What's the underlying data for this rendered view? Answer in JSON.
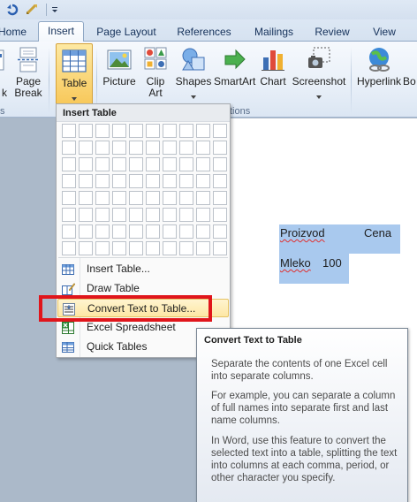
{
  "quick_access": {
    "icons": [
      "undo-icon",
      "redo-icon",
      "customize-chevron-icon"
    ]
  },
  "tabs": [
    {
      "label": "Home"
    },
    {
      "label": "Insert",
      "active": true
    },
    {
      "label": "Page Layout"
    },
    {
      "label": "References"
    },
    {
      "label": "Mailings"
    },
    {
      "label": "Review"
    },
    {
      "label": "View"
    }
  ],
  "ribbon": {
    "buttons": {
      "cover_page_fragment": "k",
      "page_break": "Page\nBreak",
      "table": "Table",
      "picture": "Picture",
      "clip_art": "Clip\nArt",
      "shapes": "Shapes",
      "smartart": "SmartArt",
      "chart": "Chart",
      "screenshot": "Screenshot",
      "hyperlink": "Hyperlink",
      "bookmark_fragment": "Bo"
    },
    "group_labels": {
      "pages_fragment": "s",
      "illustrations_fragment": "tions"
    }
  },
  "document": {
    "words": [
      "Proizvod",
      "Cena",
      "Mleko",
      "100"
    ]
  },
  "menu": {
    "header": "Insert Table",
    "grid_cols": 10,
    "grid_rows": 8,
    "items": [
      {
        "label": "Insert Table...",
        "icon": "insert-table-icon"
      },
      {
        "label": "Draw Table",
        "icon": "draw-table-icon"
      },
      {
        "label": "Convert Text to Table...",
        "icon": "convert-text-to-table-icon",
        "highlighted": true
      },
      {
        "label": "Excel Spreadsheet",
        "icon": "excel-spreadsheet-icon"
      },
      {
        "label": "Quick Tables",
        "icon": "quick-tables-icon"
      }
    ]
  },
  "tooltip": {
    "title": "Convert Text to Table",
    "paragraphs": [
      "Separate the contents of one Excel cell into separate columns.",
      "For example, you can separate a column of full names into separate first and last name columns.",
      "In Word, use this feature to convert the selected text into a table, splitting the text into columns at each comma, period, or other character you specify."
    ]
  },
  "colors": {
    "highlight_border": "#e0151b",
    "selection": "#a9c9ee",
    "menu_hover": "#fde7a5"
  }
}
